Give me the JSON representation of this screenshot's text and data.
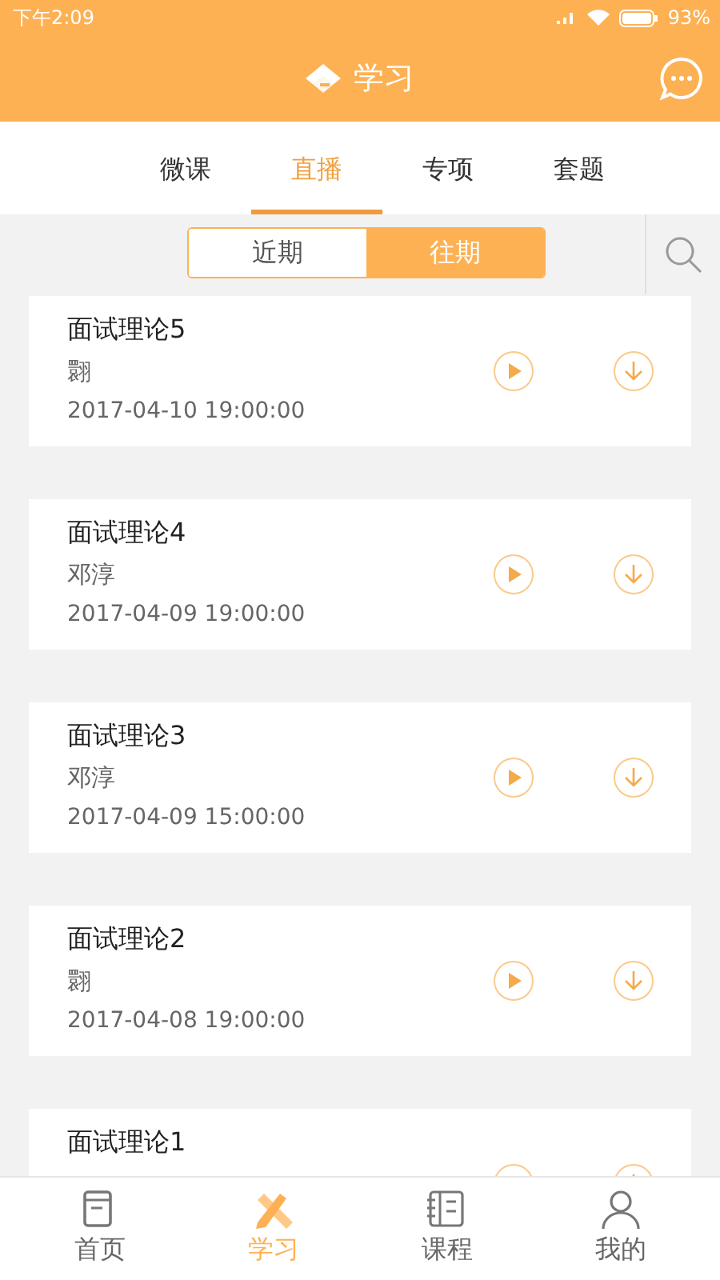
{
  "status_bar": {
    "time": "下午2:09",
    "battery": "93%"
  },
  "header": {
    "title": "学习"
  },
  "tabs": [
    {
      "label": "微课",
      "selected": false
    },
    {
      "label": "直播",
      "selected": true
    },
    {
      "label": "专项",
      "selected": false
    },
    {
      "label": "套题",
      "selected": false
    }
  ],
  "period_switch": [
    {
      "label": "近期",
      "selected": false
    },
    {
      "label": "往期",
      "selected": true
    }
  ],
  "lessons": [
    {
      "title": "面试理论5",
      "teacher": "翾",
      "time": "2017-04-10 19:00:00"
    },
    {
      "title": "面试理论4",
      "teacher": "邓淳",
      "time": "2017-04-09 19:00:00"
    },
    {
      "title": "面试理论3",
      "teacher": "邓淳",
      "time": "2017-04-09 15:00:00"
    },
    {
      "title": "面试理论2",
      "teacher": "翾",
      "time": "2017-04-08 19:00:00"
    },
    {
      "title": "面试理论1"
    }
  ],
  "bottom_nav": [
    {
      "kind": "home",
      "label": "首页",
      "selected": false
    },
    {
      "kind": "study",
      "label": "学习",
      "selected": true
    },
    {
      "kind": "course",
      "label": "课程",
      "selected": false
    },
    {
      "kind": "profile",
      "label": "我的",
      "selected": false
    }
  ]
}
